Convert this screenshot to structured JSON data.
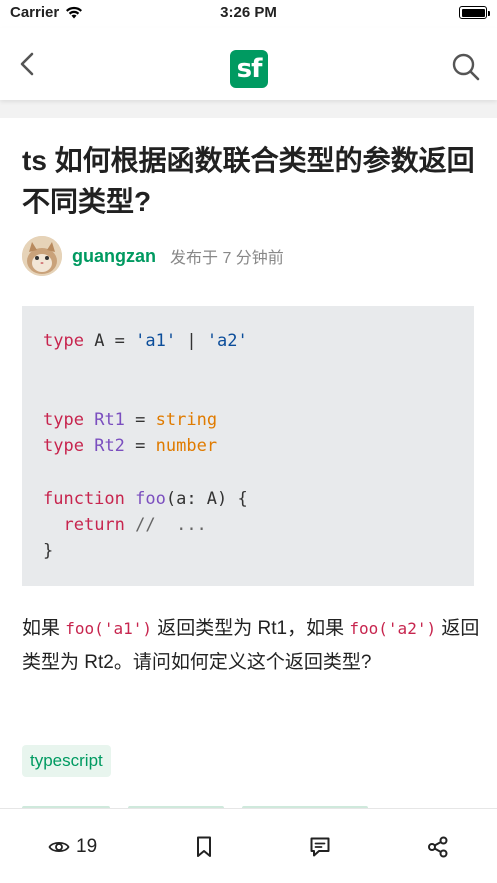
{
  "status_bar": {
    "carrier": "Carrier",
    "time": "3:26 PM",
    "wifi_icon": "wifi-icon",
    "battery_icon": "battery-icon"
  },
  "nav": {
    "back_icon": "chevron-left-icon",
    "logo_text": "sf",
    "logo_color": "#009a61",
    "search_icon": "search-icon"
  },
  "post": {
    "title": "ts 如何根据函数联合类型的参数返回不同类型?",
    "author": "guangzan",
    "published": "发布于 7 分钟前",
    "code_lines": [
      [
        {
          "t": "type",
          "c": "kw"
        },
        {
          "t": " A = ",
          "c": ""
        },
        {
          "t": "'a1'",
          "c": "str"
        },
        {
          "t": " | ",
          "c": ""
        },
        {
          "t": "'a2'",
          "c": "str"
        }
      ],
      [],
      [],
      [
        {
          "t": "type",
          "c": "kw"
        },
        {
          "t": " ",
          "c": ""
        },
        {
          "t": "Rt1",
          "c": "ty"
        },
        {
          "t": " = ",
          "c": ""
        },
        {
          "t": "string",
          "c": "bi"
        }
      ],
      [
        {
          "t": "type",
          "c": "kw"
        },
        {
          "t": " ",
          "c": ""
        },
        {
          "t": "Rt2",
          "c": "ty"
        },
        {
          "t": " = ",
          "c": ""
        },
        {
          "t": "number",
          "c": "bi"
        }
      ],
      [],
      [
        {
          "t": "function",
          "c": "kw"
        },
        {
          "t": " ",
          "c": ""
        },
        {
          "t": "foo",
          "c": "fn"
        },
        {
          "t": "(a: A) {",
          "c": ""
        }
      ],
      [
        {
          "t": "  ",
          "c": ""
        },
        {
          "t": "return",
          "c": "kw"
        },
        {
          "t": " //  ...",
          "c": "cm"
        }
      ],
      [
        {
          "t": "}",
          "c": ""
        }
      ]
    ],
    "paragraph": {
      "p1": "如果 ",
      "code1": "foo('a1')",
      "p2": " 返回类型为 Rt1，如果 ",
      "code2": "foo('a2')",
      "p3": " 返回类型为 Rt2。请问如何定义这个返回类型?"
    },
    "tag": "typescript"
  },
  "bottom_bar": {
    "views_icon": "eye-icon",
    "views": "19",
    "bookmark_icon": "bookmark-icon",
    "comment_icon": "comment-icon",
    "share_icon": "share-icon"
  }
}
